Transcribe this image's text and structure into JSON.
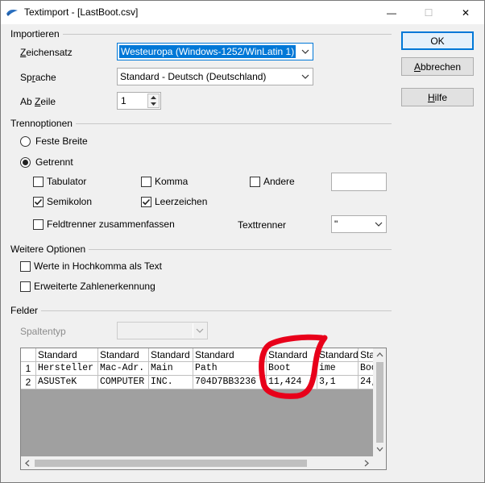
{
  "window": {
    "title": "Textimport - [LastBoot.csv]",
    "minimize_glyph": "—",
    "maximize_glyph": "☐",
    "close_glyph": "✕"
  },
  "import": {
    "group_title": "Importieren",
    "charset_label": "Zeichensatz",
    "charset_value": "Westeuropa (Windows-1252/WinLatin 1)",
    "language_label": "Sprache",
    "language_value": "Standard - Deutsch (Deutschland)",
    "from_row_label": "Ab Zeile",
    "from_row_value": "1"
  },
  "separator": {
    "group_title": "Trennoptionen",
    "fixed_width": "Feste Breite",
    "separated": "Getrennt",
    "tab": "Tabulator",
    "comma": "Komma",
    "other": "Andere",
    "semicolon": "Semikolon",
    "space": "Leerzeichen",
    "merge": "Feldtrenner zusammenfassen",
    "text_delimiter_label": "Texttrenner",
    "text_delimiter_value": "\"",
    "checked": {
      "fixed_width": false,
      "separated": true,
      "tab": false,
      "comma": false,
      "other": false,
      "semicolon": true,
      "space": true,
      "merge": false
    }
  },
  "other_options": {
    "group_title": "Weitere Optionen",
    "quoted_as_text": "Werte in Hochkomma als Text",
    "detect_special_numbers": "Erweiterte Zahlenerkennung"
  },
  "fields": {
    "group_title": "Felder",
    "column_type_label": "Spaltentyp",
    "column_type_value": ""
  },
  "buttons": {
    "ok": "OK",
    "cancel": "Abbrechen",
    "help": "Hilfe"
  },
  "preview": {
    "headers": [
      "Standard",
      "Standard",
      "Standard",
      "Standard",
      "Standard",
      "Standard",
      "Sta"
    ],
    "rows": [
      {
        "num": "1",
        "cells": [
          "Hersteller",
          "Mac-Adr.",
          "Main",
          "Path",
          "Boot",
          "ime",
          "Boo"
        ]
      },
      {
        "num": "2",
        "cells": [
          "ASUSTeK",
          "COMPUTER",
          "INC.",
          "704D7BB3236",
          "11,424",
          "3,1",
          "24,"
        ]
      }
    ]
  },
  "annotation": {
    "color": "#e8001a"
  }
}
